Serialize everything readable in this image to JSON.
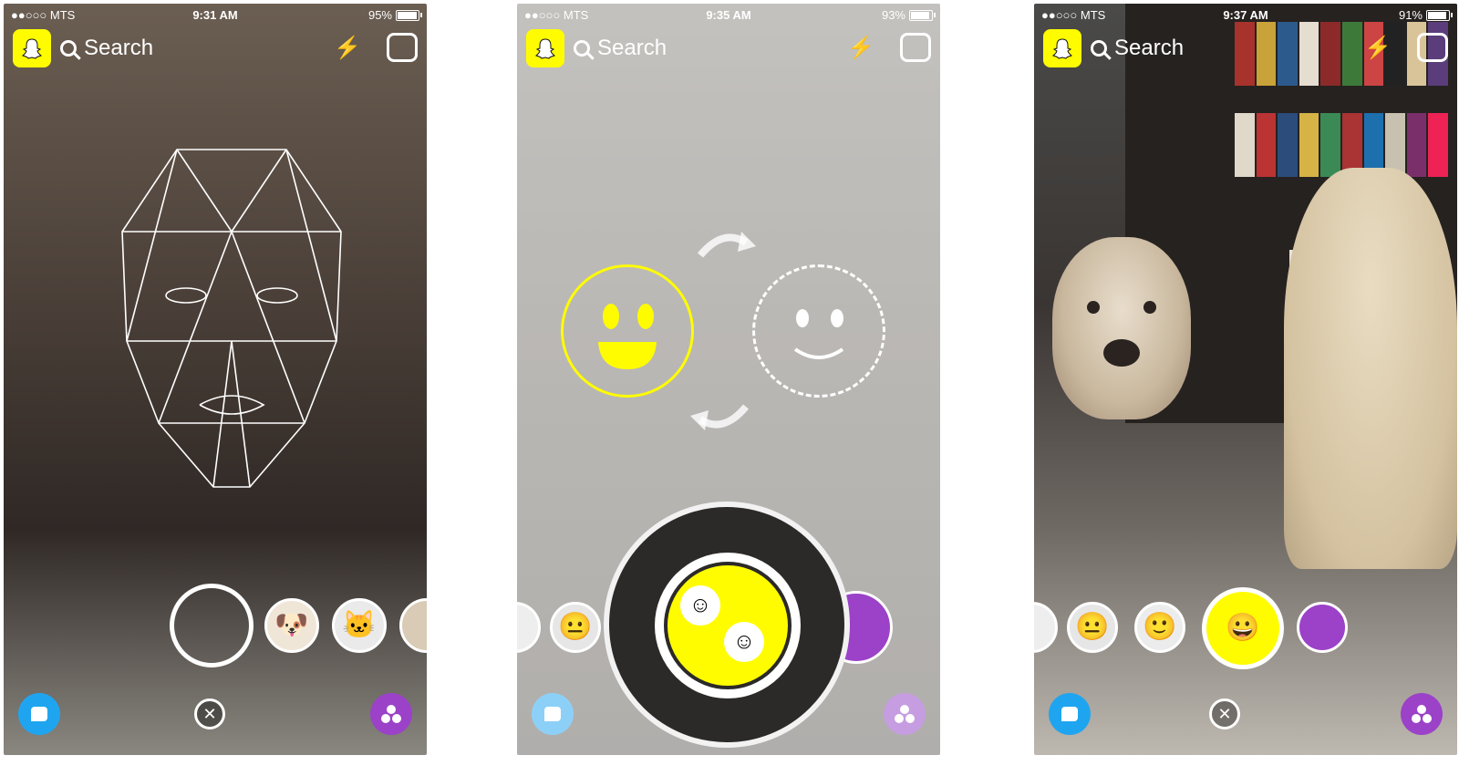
{
  "panels": [
    {
      "status": {
        "carrier": "●●○○○ MTS",
        "time": "9:31 AM",
        "battery": "95%",
        "battery_level": 0.95
      },
      "search_placeholder": "Search",
      "lenses": [
        "empty-circle",
        "dog-and-person-lens",
        "cat-lens",
        "partial-lens"
      ]
    },
    {
      "status": {
        "carrier": "●●○○○ MTS",
        "time": "9:35 AM",
        "battery": "93%",
        "battery_level": 0.93
      },
      "search_placeholder": "Search",
      "lenses": [
        "partial-lens",
        "ghost-face-lens",
        "partial-lens",
        "face-swap-lens",
        "purple-lens"
      ]
    },
    {
      "status": {
        "carrier": "●●○○○ MTS",
        "time": "9:37 AM",
        "battery": "91%",
        "battery_level": 0.91
      },
      "search_placeholder": "Search",
      "lenses": [
        "partial-lens",
        "ghost-face-lens",
        "pale-face-lens",
        "face-swap-lens",
        "purple-camera-lens"
      ]
    }
  ],
  "icons": {
    "ghost": "snapchat-ghost-icon",
    "search": "search-icon",
    "flash": "flash-off-icon",
    "flip": "camera-flip-icon",
    "chat": "chat-icon",
    "close": "close-icon",
    "stories": "stories-icon"
  },
  "colors": {
    "snap_yellow": "#fffc00",
    "chat_blue": "#1fa5f0",
    "stories_purple": "#9b42c8"
  },
  "glyphs": {
    "flash": "⚡",
    "close": "✕"
  }
}
